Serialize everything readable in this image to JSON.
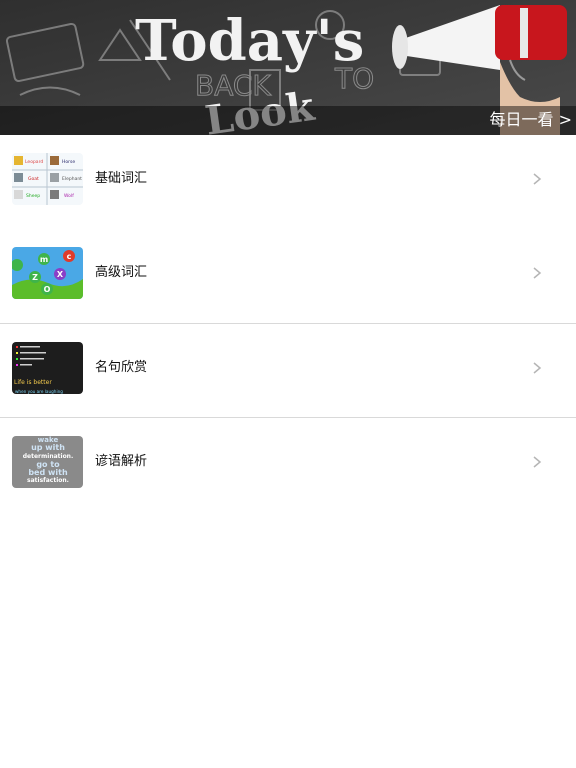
{
  "banner": {
    "caption": "每日一看 >",
    "image_text": [
      "Today's",
      "Look",
      "BACK",
      "TO"
    ]
  },
  "list": [
    {
      "label": "基础词汇",
      "thumb_words": [
        "Leopard",
        "Horse",
        "Goat",
        "Elephant",
        "Sheep",
        "Wolf"
      ]
    },
    {
      "label": "高级词汇",
      "thumb_letters": [
        "m",
        "c",
        "Z",
        "X",
        "O"
      ]
    },
    {
      "label": "名句欣赏",
      "thumb_words": [
        "Life is better",
        "when you are laughing"
      ]
    },
    {
      "label": "谚语解析",
      "thumb_words": [
        "wake",
        "up with",
        "determination.",
        "go to",
        "bed with",
        "satisfaction."
      ]
    }
  ]
}
